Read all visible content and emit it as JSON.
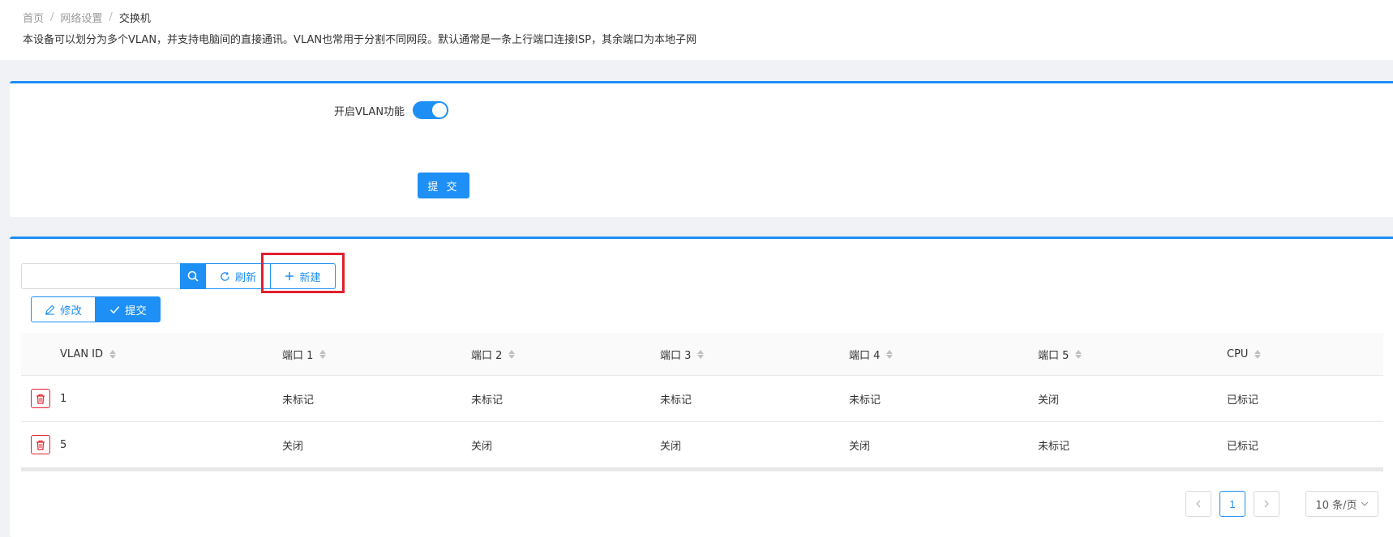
{
  "breadcrumb": {
    "home": "首页",
    "network": "网络设置",
    "current": "交换机",
    "separator": "/"
  },
  "description": "本设备可以划分为多个VLAN，并支持电脑间的直接通讯。VLAN也常用于分割不同网段。默认通常是一条上行端口连接ISP，其余端口为本地子网",
  "vlan_toggle": {
    "label": "开启VLAN功能",
    "enabled": true
  },
  "submit_label": "提 交",
  "toolbar": {
    "search_value": "",
    "refresh_label": "刷新",
    "new_label": "新建",
    "edit_label": "修改",
    "commit_label": "提交"
  },
  "table": {
    "headers": [
      "VLAN ID",
      "端口 1",
      "端口 2",
      "端口 3",
      "端口 4",
      "端口 5",
      "CPU"
    ],
    "rows": [
      [
        "1",
        "未标记",
        "未标记",
        "未标记",
        "未标记",
        "关闭",
        "已标记"
      ],
      [
        "5",
        "关闭",
        "关闭",
        "关闭",
        "关闭",
        "未标记",
        "已标记"
      ]
    ]
  },
  "pagination": {
    "current_page": "1",
    "page_size": "10 条/页"
  },
  "colors": {
    "primary": "#1e8ff5",
    "danger": "#e0202b",
    "highlight": "#e0202b"
  },
  "icons": [
    "search-icon",
    "refresh-icon",
    "plus-icon",
    "edit-icon",
    "check-icon",
    "trash-icon",
    "chevron-left-icon",
    "chevron-right-icon",
    "chevron-down-icon"
  ]
}
